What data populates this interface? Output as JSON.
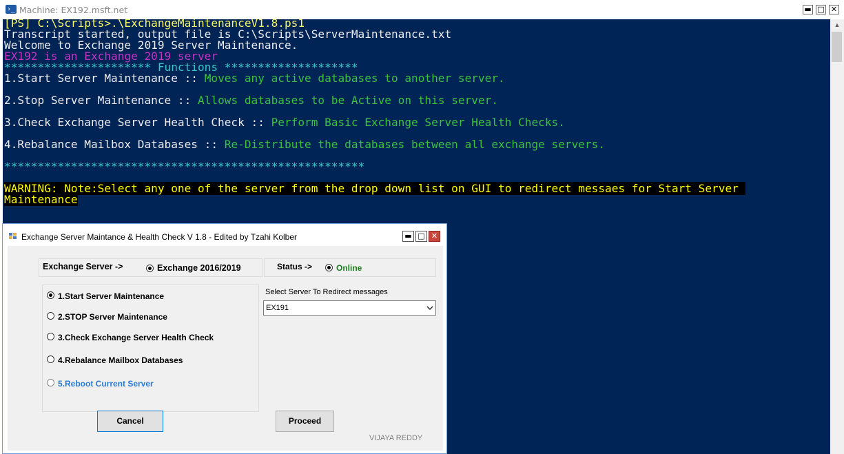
{
  "ps_window": {
    "title": "Machine: EX192.msft.net",
    "controls": {
      "minimize": "▬",
      "maximize": "□",
      "close": "✕"
    }
  },
  "console": {
    "lines": [
      "[PS] C:\\Scripts>.\\ExchangeMaintenanceV1.8.ps1",
      "Transcript started, output file is C:\\Scripts\\ServerMaintenance.txt",
      "Welcome to Exchange 2019 Server Maintenance.",
      "EX192 is an Exchange 2019 server",
      "********************** ",
      "Functions",
      " ********************",
      "1.Start Server Maintenance :: ",
      "Moves any active databases to another server.",
      "2.Stop Server Maintenance :: ",
      "Allows databases to be Active on this server.",
      "3.Check Exchange Server Health Check :: ",
      "Perform Basic Exchange Server Health Checks.",
      "4.Rebalance Mailbox Databases :: ",
      "Re-Distribute the databases between all exchange servers.",
      "******************************************************",
      "WARNING: Note:Select any one of the server from the drop down list on GUI to redirect messaes for Start Server ",
      "Maintenance"
    ]
  },
  "dialog": {
    "title": "Exchange Server Maintance & Health Check V 1.8 - Edited by Tzahi Kolber",
    "controls": {
      "minimize": "▬",
      "maximize": "□",
      "close": "✕"
    },
    "exchange_server_label": "Exchange Server ->",
    "exchange_version_option": "Exchange 2016/2019",
    "status_label": "Status ->",
    "status_value": "Online",
    "redirect_label": "Select Server To Redirect messages",
    "selected_server": "EX191",
    "options": [
      {
        "label": "1.Start Server Maintenance",
        "checked": true
      },
      {
        "label": "2.STOP Server Maintenance",
        "checked": false
      },
      {
        "label": "3.Check Exchange Server Health Check",
        "checked": false
      },
      {
        "label": "4.Rebalance Mailbox Databases",
        "checked": false
      },
      {
        "label": "5.Reboot Current Server",
        "checked": false
      }
    ],
    "cancel_label": "Cancel",
    "proceed_label": "Proceed",
    "author": "VIJAYA REDDY",
    "colors": {
      "online": "#1a7f1a",
      "reboot": "#2a7bd4",
      "author": "#808080"
    }
  }
}
